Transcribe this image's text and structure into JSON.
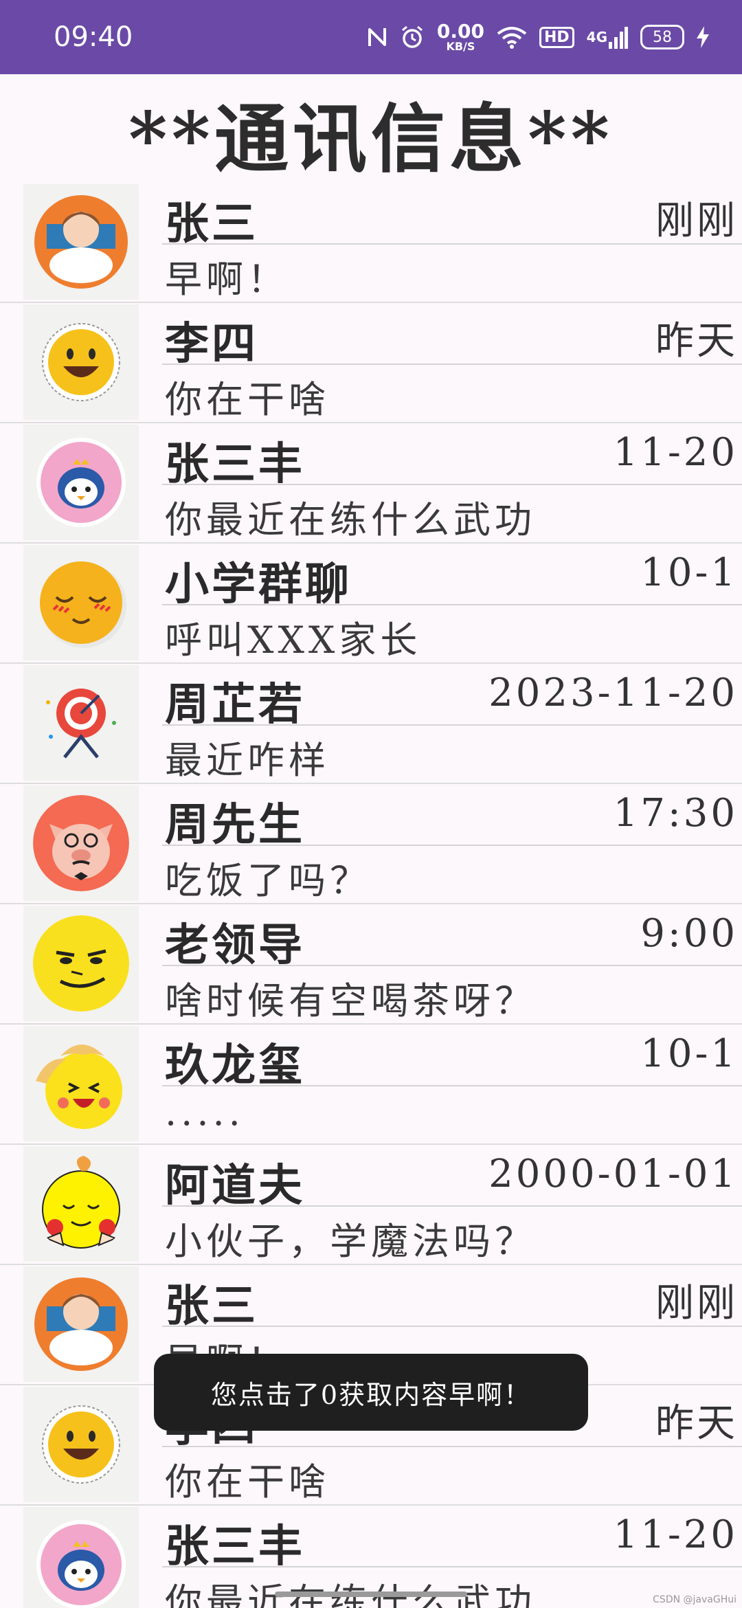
{
  "status_bar": {
    "time": "09:40",
    "net_speed_value": "0.00",
    "net_speed_unit": "KB/S",
    "hd": "HD",
    "signal": "4G",
    "battery": "58"
  },
  "page": {
    "title": "**通讯信息**"
  },
  "contacts": [
    {
      "name": "张三",
      "time": "刚刚",
      "message": "早啊！",
      "avatar": "girl-avatar"
    },
    {
      "name": "李四",
      "time": "昨天",
      "message": "你在干啥",
      "avatar": "smiley-avatar"
    },
    {
      "name": "张三丰",
      "time": "11-20",
      "message": "你最近在练什么武功",
      "avatar": "penguin-avatar"
    },
    {
      "name": "小学群聊",
      "time": "10-1",
      "message": "呼叫XXX家长",
      "avatar": "sleepy-face-avatar"
    },
    {
      "name": "周芷若",
      "time": "2023-11-20",
      "message": "最近咋样",
      "avatar": "target-avatar"
    },
    {
      "name": "周先生",
      "time": "17:30",
      "message": "吃饭了吗？",
      "avatar": "pig-avatar"
    },
    {
      "name": "老领导",
      "time": "9:00",
      "message": "啥时候有空喝茶呀？",
      "avatar": "smirk-face-avatar"
    },
    {
      "name": "玖龙玺",
      "time": "10-1",
      "message": ".....",
      "avatar": "laughing-face-avatar"
    },
    {
      "name": "阿道夫",
      "time": "2000-01-01",
      "message": "小伙子，学魔法吗？",
      "avatar": "pointing-face-avatar"
    },
    {
      "name": "张三",
      "time": "刚刚",
      "message": "早啊！",
      "avatar": "girl-avatar"
    },
    {
      "name": "李四",
      "time": "昨天",
      "message": "你在干啥",
      "avatar": "smiley-avatar"
    },
    {
      "name": "张三丰",
      "time": "11-20",
      "message": "你最近在练什么武功",
      "avatar": "penguin-avatar"
    }
  ],
  "toast": {
    "text": "您点击了0获取内容早啊！"
  },
  "watermark": "CSDN @javaGHui",
  "colors": {
    "status_bar": "#6a4aa6",
    "background": "#fdf8fc",
    "toast": "#1f1f1f"
  }
}
